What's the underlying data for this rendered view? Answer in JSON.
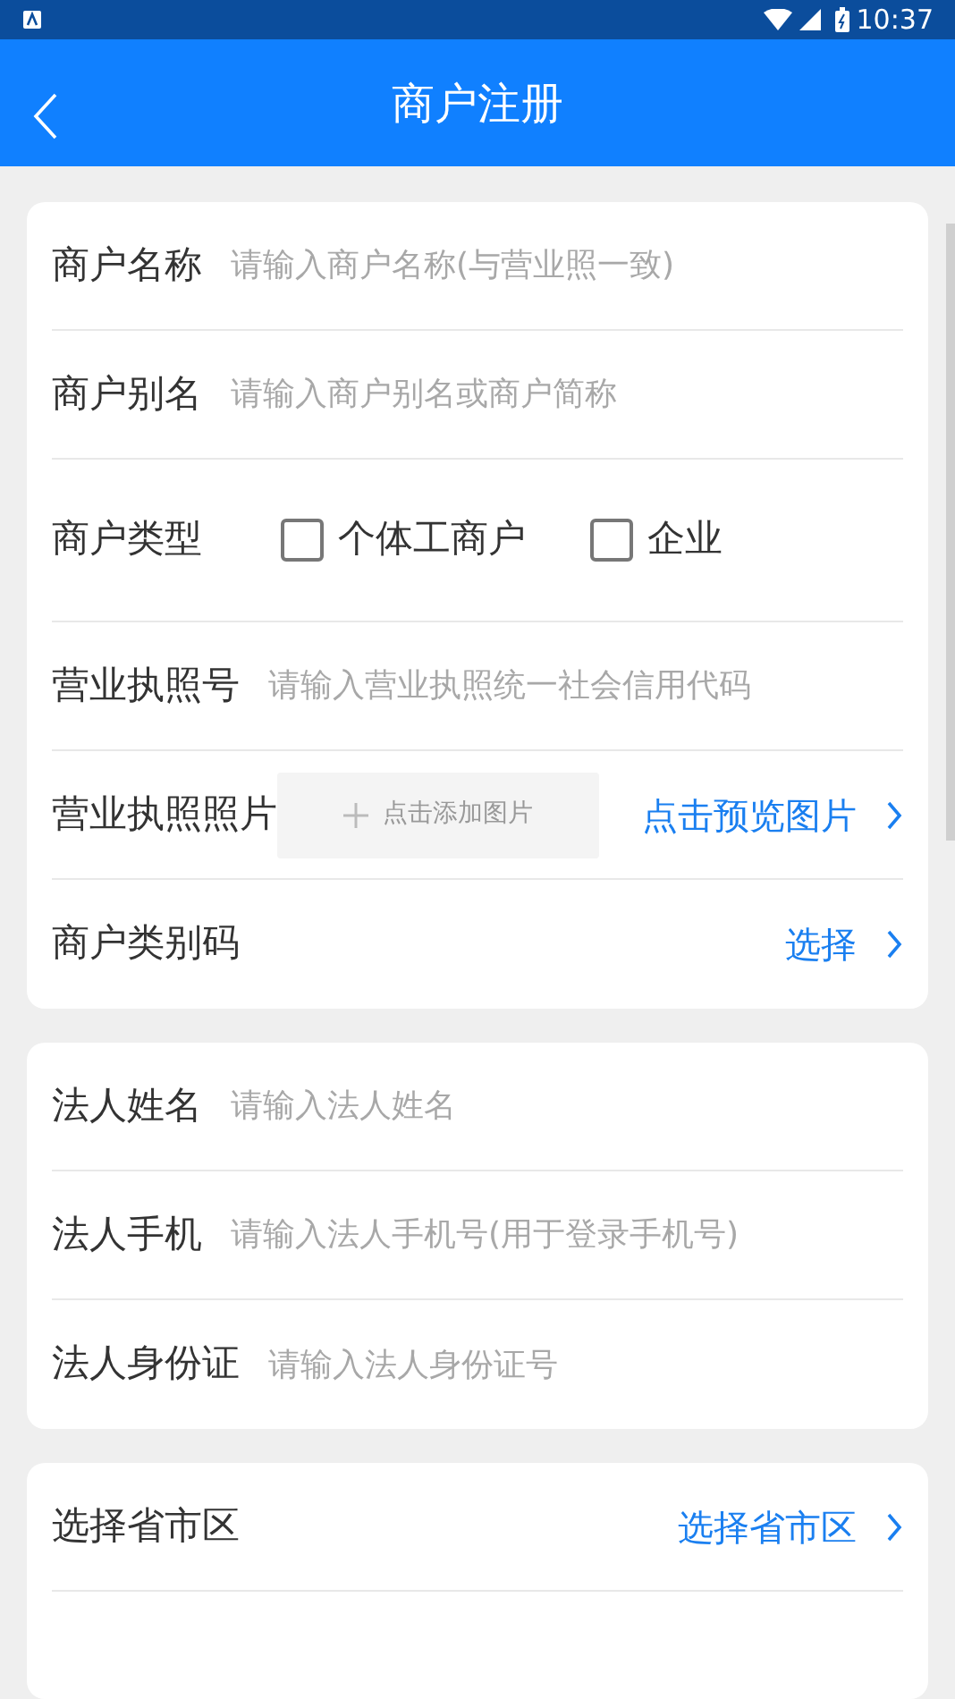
{
  "status_bar": {
    "time": "10:37"
  },
  "header": {
    "title": "商户注册"
  },
  "sections": [
    {
      "rows": [
        {
          "kind": "input",
          "label": "商户名称",
          "placeholder": "请输入商户名称(与营业照一致)"
        },
        {
          "kind": "input",
          "label": "商户别名",
          "placeholder": "请输入商户别名或商户简称"
        },
        {
          "kind": "checkbox",
          "label": "商户类型",
          "options": [
            {
              "label": "个体工商户",
              "checked": false
            },
            {
              "label": "企业",
              "checked": false
            }
          ]
        },
        {
          "kind": "input",
          "label": "营业执照号",
          "placeholder": "请输入营业执照统一社会信用代码"
        },
        {
          "kind": "image",
          "label": "营业执照照片",
          "add_label": "点击添加图片",
          "action": "点击预览图片"
        },
        {
          "kind": "select",
          "label": "商户类别码",
          "action": "选择"
        }
      ]
    },
    {
      "rows": [
        {
          "kind": "input",
          "label": "法人姓名",
          "placeholder": "请输入法人姓名"
        },
        {
          "kind": "input",
          "label": "法人手机",
          "placeholder": "请输入法人手机号(用于登录手机号)"
        },
        {
          "kind": "input",
          "label": "法人身份证",
          "placeholder": "请输入法人身份证号"
        }
      ]
    },
    {
      "rows": [
        {
          "kind": "select",
          "label": "选择省市区",
          "action": "选择省市区"
        }
      ]
    }
  ]
}
